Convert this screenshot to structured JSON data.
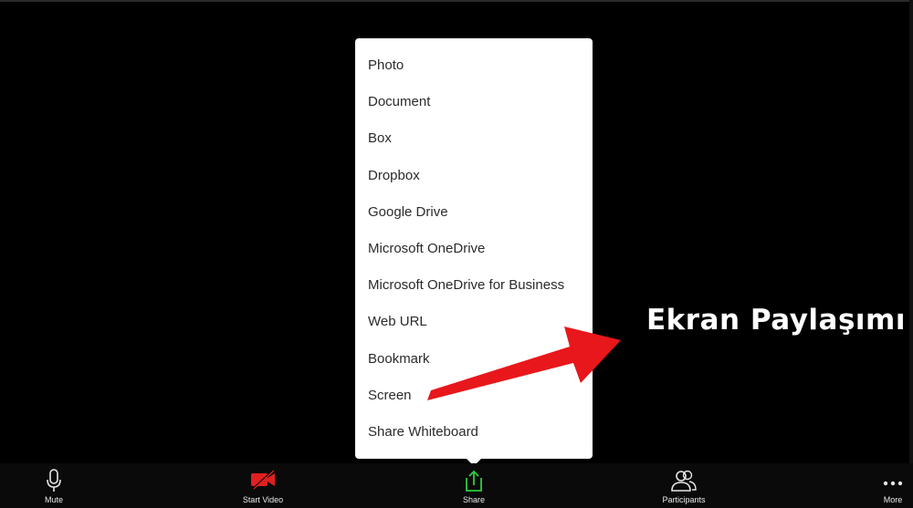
{
  "share_menu": {
    "items": [
      {
        "label": "Photo"
      },
      {
        "label": "Document"
      },
      {
        "label": "Box"
      },
      {
        "label": "Dropbox"
      },
      {
        "label": "Google Drive"
      },
      {
        "label": "Microsoft OneDrive"
      },
      {
        "label": "Microsoft OneDrive for Business"
      },
      {
        "label": "Web URL"
      },
      {
        "label": "Bookmark"
      },
      {
        "label": "Screen"
      },
      {
        "label": "Share Whiteboard"
      }
    ]
  },
  "annotation": {
    "text": "Ekran Paylaşımı",
    "arrow_color": "#e8171b"
  },
  "toolbar": {
    "buttons": [
      {
        "label": "Mute",
        "icon": "microphone-icon"
      },
      {
        "label": "Start Video",
        "icon": "video-off-icon"
      },
      {
        "label": "Share",
        "icon": "share-screen-icon"
      },
      {
        "label": "Participants",
        "icon": "participants-icon"
      },
      {
        "label": "More",
        "icon": "more-dots-icon"
      }
    ]
  },
  "colors": {
    "background": "#000000",
    "menu_background": "#ffffff",
    "share_accent": "#2ecc40",
    "video_off": "#e0201f"
  }
}
